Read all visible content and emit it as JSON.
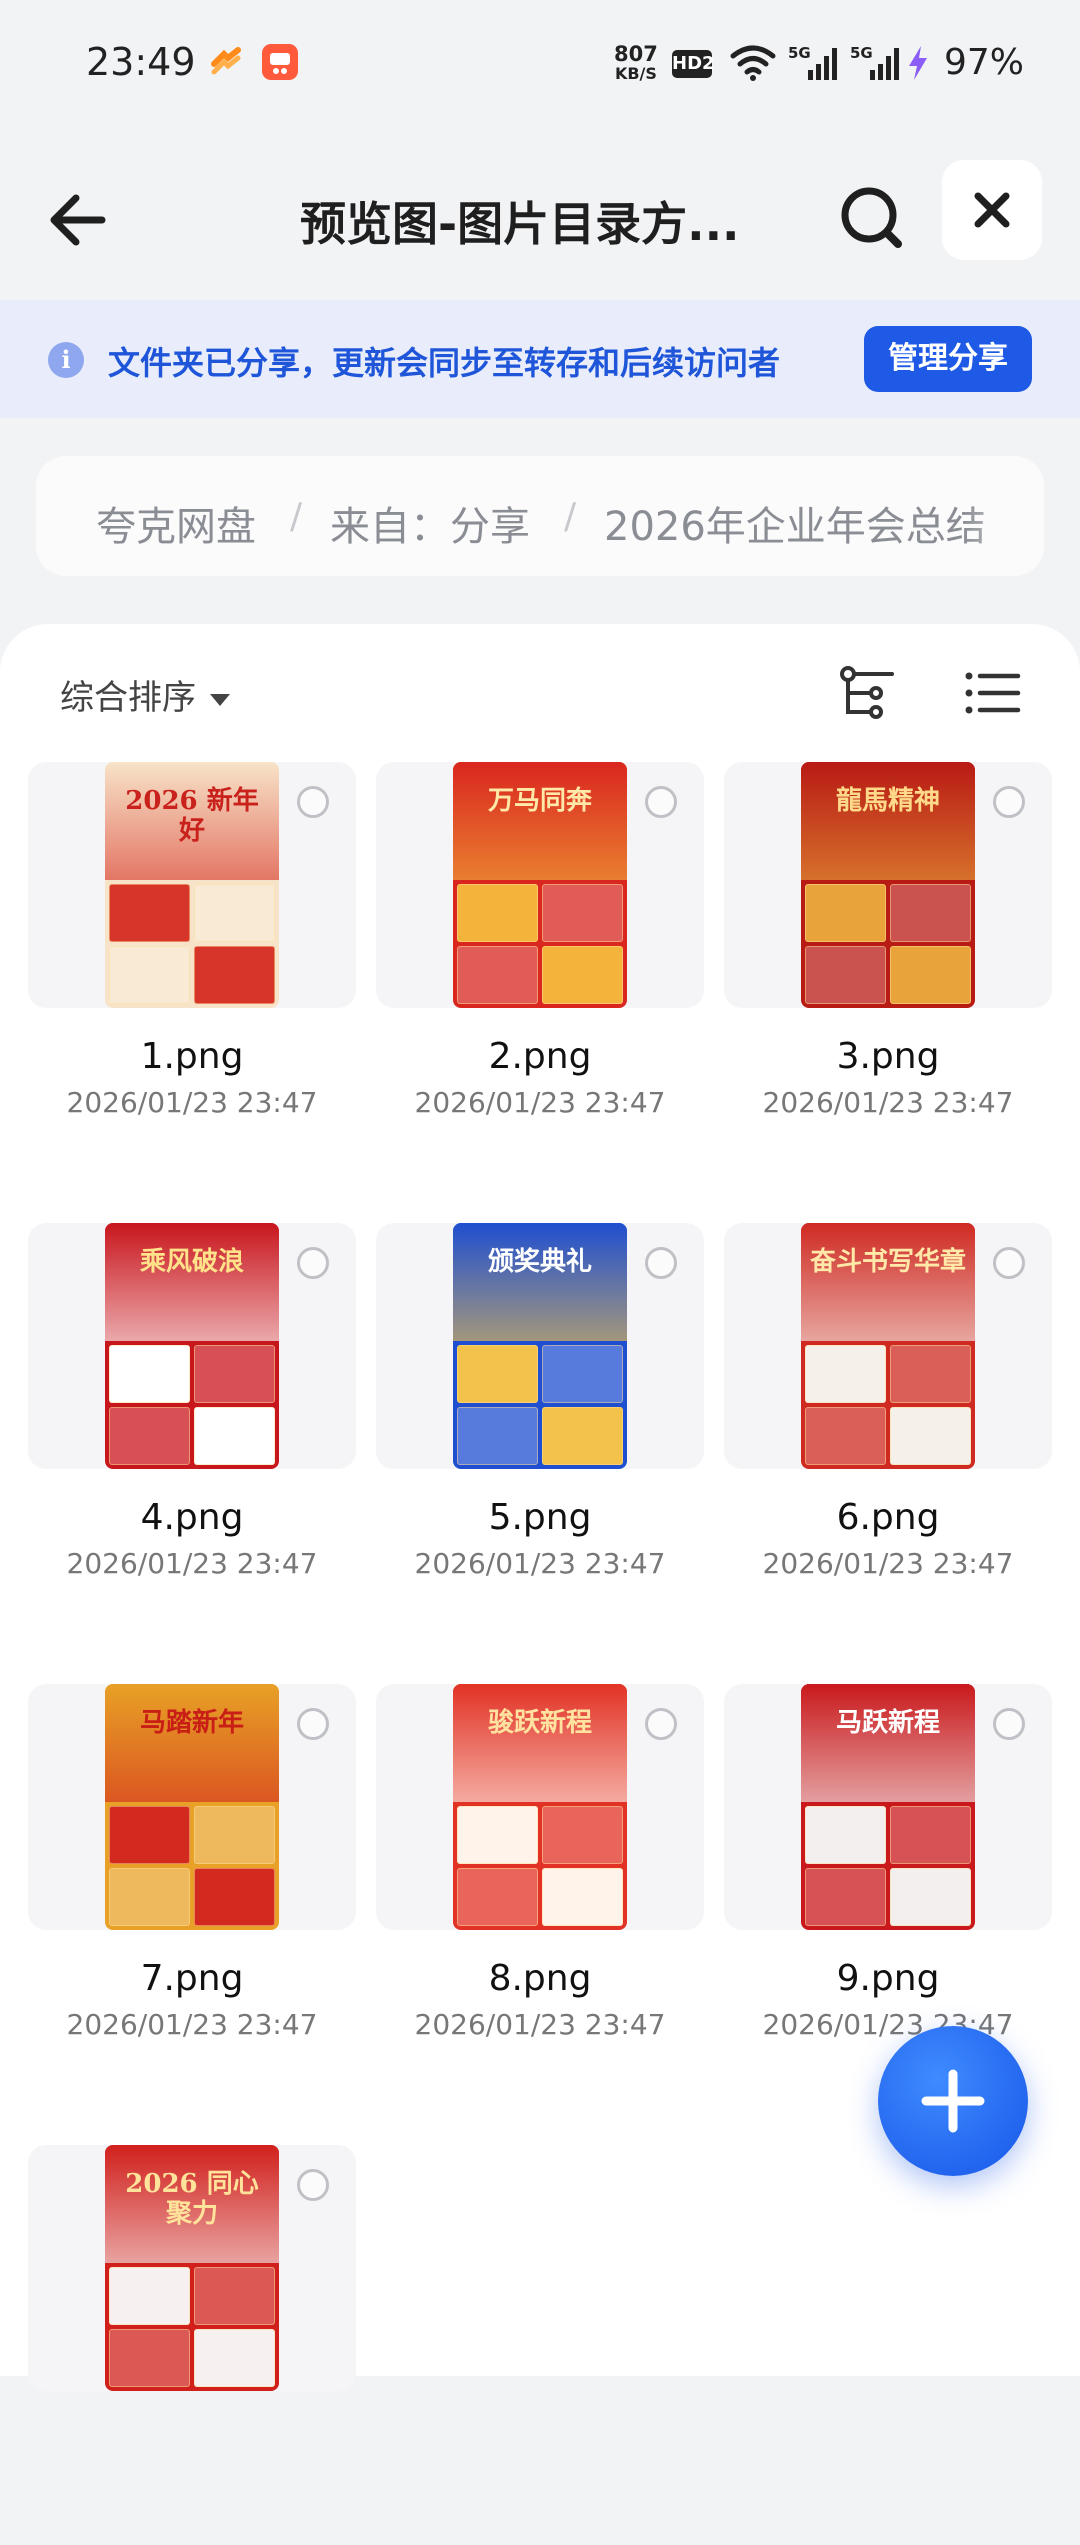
{
  "status_bar": {
    "time": "23:49",
    "net_speed_value": "807",
    "net_speed_unit": "KB/S",
    "hd_label": "HD2",
    "battery": "97%"
  },
  "header": {
    "title": "预览图-图片目录方..."
  },
  "notice": {
    "text": "文件夹已分享，更新会同步至转存和后续访问者",
    "manage_button": "管理分享"
  },
  "breadcrumb": {
    "items": [
      "夸克网盘",
      "来自：分享",
      "2026年企业年会总结"
    ],
    "separator": "/"
  },
  "toolbar": {
    "sort_label": "综合排序"
  },
  "files": [
    {
      "name": "1.png",
      "date": "2026/01/23 23:47",
      "thumb_title": "2026 新年好",
      "thumb_bg": "#f7e3c8",
      "thumb_accent": "#d8352a",
      "title_color": "#c9221c"
    },
    {
      "name": "2.png",
      "date": "2026/01/23 23:47",
      "thumb_title": "万马同奔",
      "thumb_bg": "#d9261f",
      "thumb_accent": "#f4b33a",
      "title_color": "#ffe8a8"
    },
    {
      "name": "3.png",
      "date": "2026/01/23 23:47",
      "thumb_title": "龍馬精神",
      "thumb_bg": "#b81a14",
      "thumb_accent": "#e8a43a",
      "title_color": "#ffd98a"
    },
    {
      "name": "4.png",
      "date": "2026/01/23 23:47",
      "thumb_title": "乘风破浪",
      "thumb_bg": "#c8161d",
      "thumb_accent": "#ffffff",
      "title_color": "#ffe28a"
    },
    {
      "name": "5.png",
      "date": "2026/01/23 23:47",
      "thumb_title": "颁奖典礼",
      "thumb_bg": "#1f4fd0",
      "thumb_accent": "#f2c24a",
      "title_color": "#ffffff"
    },
    {
      "name": "6.png",
      "date": "2026/01/23 23:47",
      "thumb_title": "奋斗书写华章",
      "thumb_bg": "#cf2a22",
      "thumb_accent": "#f5f0ea",
      "title_color": "#ffe8a8"
    },
    {
      "name": "7.png",
      "date": "2026/01/23 23:47",
      "thumb_title": "马踏新年",
      "thumb_bg": "#e8a126",
      "thumb_accent": "#d32a1f",
      "title_color": "#c81e16"
    },
    {
      "name": "8.png",
      "date": "2026/01/23 23:47",
      "thumb_title": "骏跃新程",
      "thumb_bg": "#e23225",
      "thumb_accent": "#fff3ea",
      "title_color": "#ffe2a0"
    },
    {
      "name": "9.png",
      "date": "2026/01/23 23:47",
      "thumb_title": "马跃新程",
      "thumb_bg": "#c9191c",
      "thumb_accent": "#f3efef",
      "title_color": "#ffffff"
    },
    {
      "name": "",
      "date": "",
      "thumb_title": "2026 同心聚力",
      "thumb_bg": "#d1201c",
      "thumb_accent": "#f6f1f0",
      "title_color": "#ffe39a"
    }
  ],
  "icons": {
    "back": "arrow-left-icon",
    "search": "search-icon",
    "close": "close-icon",
    "info": "info-icon",
    "sort": "caret-down-icon",
    "tree": "tree-view-icon",
    "list": "list-view-icon",
    "fab": "plus-icon"
  },
  "colors": {
    "accent": "#1e5ae6",
    "notice_bg": "#e9edfb",
    "notice_text": "#1f56d9"
  }
}
